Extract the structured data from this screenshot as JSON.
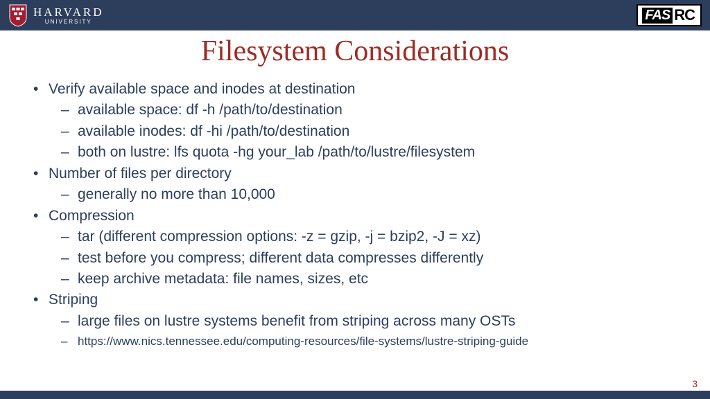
{
  "header": {
    "logo_main": "HARVARD",
    "logo_sub": "UNIVERSITY",
    "fasrc_fas": "FAS",
    "fasrc_rc": "RC"
  },
  "title": "Filesystem Considerations",
  "bullets": {
    "b1": "Verify available space and inodes at destination",
    "b1s1": "available space: df -h /path/to/destination",
    "b1s2": "available inodes: df -hi /path/to/destination",
    "b1s3": "both on lustre: lfs quota -hg your_lab /path/to/lustre/filesystem",
    "b2": "Number of files per directory",
    "b2s1": "generally no more than 10,000",
    "b3": "Compression",
    "b3s1": "tar (different compression options: -z = gzip, -j = bzip2, -J = xz)",
    "b3s2": "test before you compress; different data compresses differently",
    "b3s3": "keep archive metadata: file names, sizes, etc",
    "b4": "Striping",
    "b4s1": "large files on lustre systems benefit from striping across many OSTs",
    "b4s2": "https://www.nics.tennessee.edu/computing-resources/file-systems/lustre-striping-guide"
  },
  "page_number": "3"
}
